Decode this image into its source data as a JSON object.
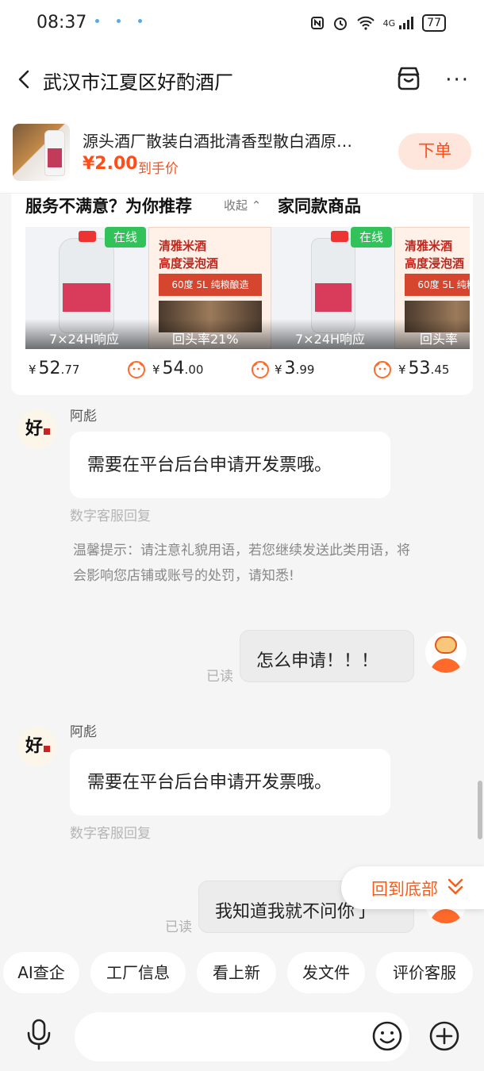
{
  "status": {
    "time": "08:37",
    "network": "4G",
    "battery": "77"
  },
  "nav": {
    "title": "武汉市江夏区好酌酒厂",
    "back_icon": "back-arrow-icon",
    "shop_icon": "shop-icon",
    "more_icon": "more-dots-icon",
    "more_label": "···"
  },
  "product": {
    "title": "源头酒厂散装白酒批清香型散白酒原…",
    "price": "¥2.00",
    "price_note": "到手价",
    "order_label": "下单",
    "accent": "#ff4d1a"
  },
  "recommend": {
    "title_prefix": "服务不满意？为你推荐",
    "collapse_label": "收起 ⌃",
    "title_suffix": "家同款商品",
    "online_label": "在线",
    "items": [
      {
        "overlay": "7×24H响应",
        "price_int": "52",
        "price_dec": ".77"
      },
      {
        "overlay": "回头率21%",
        "price_int": "54",
        "price_dec": ".00"
      },
      {
        "overlay": "7×24H响应",
        "price_int": "3",
        "price_dec": ".99"
      },
      {
        "overlay": "回头率",
        "price_int": "53",
        "price_dec": ".45"
      }
    ],
    "poster": {
      "line1": "清雅米酒",
      "line2": "高度浸泡酒",
      "box": "60度 5L 纯粮酿造"
    },
    "currency": "¥"
  },
  "messages": {
    "shop_name": "阿彪",
    "reply1": "需要在平台后台申请开发票哦。",
    "reply_note": "数字客服回复",
    "warning": "温馨提示：请注意礼貌用语，若您继续发送此类用语，将会影响您店铺或账号的处罚，请知悉!",
    "user_msg1": "怎么申请！！！",
    "read_label": "已读",
    "reply2": "需要在平台后台申请开发票哦。",
    "user_msg2": "我知道我就不问你了"
  },
  "back_bottom": {
    "label": "回到底部"
  },
  "quick_actions": [
    "AI查企",
    "工厂信息",
    "看上新",
    "发文件",
    "评价客服"
  ],
  "input": {
    "placeholder": ""
  }
}
